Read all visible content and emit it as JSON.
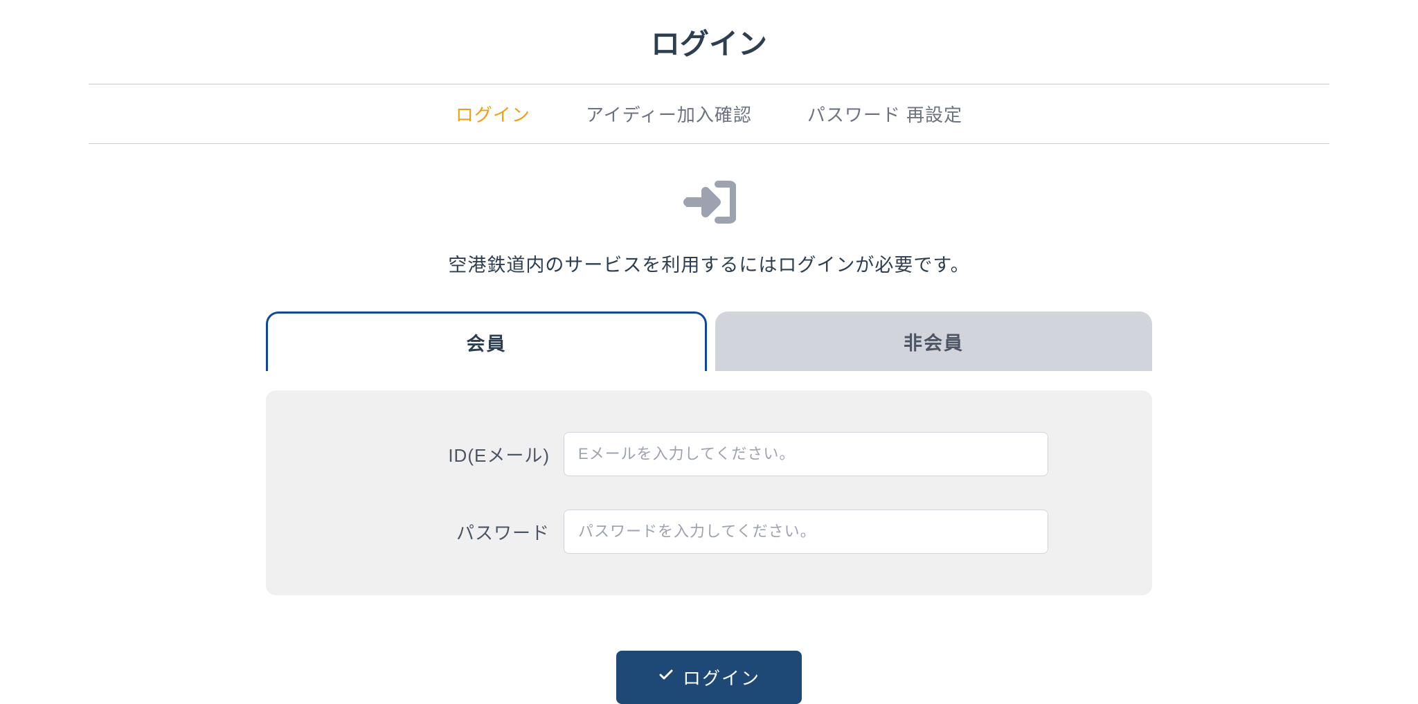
{
  "page": {
    "title": "ログイン"
  },
  "nav": {
    "tabs": [
      {
        "label": "ログイン",
        "active": true
      },
      {
        "label": "アイディー加入確認",
        "active": false
      },
      {
        "label": "パスワード 再設定",
        "active": false
      }
    ]
  },
  "content": {
    "description": "空港鉄道内のサービスを利用するにはログインが必要です。"
  },
  "memberTabs": {
    "active": "会員",
    "inactive": "非会員"
  },
  "form": {
    "idLabel": "ID(Eメール)",
    "idPlaceholder": "Eメールを入力してください。",
    "passwordLabel": "パスワード",
    "passwordPlaceholder": "パスワードを入力してください。"
  },
  "submit": {
    "label": "ログイン"
  }
}
